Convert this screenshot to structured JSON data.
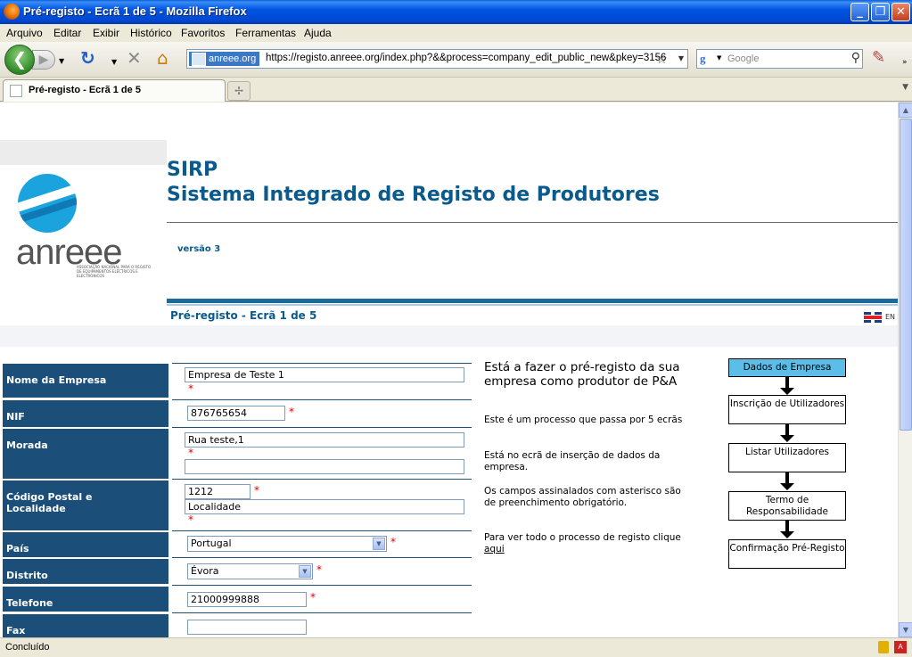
{
  "browser": {
    "window_title": "Pré-registo - Ecrã 1 de 5 - Mozilla Firefox",
    "menu": [
      "Arquivo",
      "Editar",
      "Exibir",
      "Histórico",
      "Favoritos",
      "Ferramentas",
      "Ajuda"
    ],
    "site_identity": "anreee.org",
    "url": "https://registo.anreee.org/index.php?&&process=company_edit_public_new&pkey=3156",
    "search_placeholder": "Google",
    "tab_title": "Pré-registo - Ecrã 1 de 5",
    "status": "Concluído"
  },
  "page": {
    "logo_text": "anreee",
    "logo_subtitle": "ASSOCIAÇÃO NACIONAL PARA O REGISTO DE EQUIPAMENTOS ELÉCTRICOS E ELECTRÓNICOS",
    "title_line1": "SIRP",
    "title_line2": "Sistema Integrado de Registo de Produtores",
    "version": "versão 3",
    "step_title": "Pré-registo - Ecrã 1 de 5",
    "lang": "EN"
  },
  "form": {
    "nome_label": "Nome da Empresa",
    "nome_value": "Empresa de Teste 1",
    "nif_label": "NIF",
    "nif_value": "876765654",
    "morada_label": "Morada",
    "morada_value1": "Rua teste,1",
    "morada_value2": "",
    "cp_label_1": "Código Postal e",
    "cp_label_2": "Localidade",
    "cp_value": "1212",
    "localidade_value": "Localidade",
    "pais_label": "País",
    "pais_value": "Portugal",
    "distrito_label": "Distrito",
    "distrito_value": "Évora",
    "telefone_label": "Telefone",
    "telefone_value": "21000999888",
    "fax_label": "Fax",
    "fax_value": "",
    "required_mark": "*"
  },
  "info": {
    "heading": "Está a fazer o pré-registo da sua empresa como produtor de P&A",
    "p1": "Este é um processo que passa por 5 ecrãs",
    "p2": "Está no ecrã de inserção de dados da empresa.",
    "p3": "Os campos assinalados com asterisco são de preenchimento obrigatório.",
    "p4": "Para ver todo o processo de registo clique",
    "p4_link": "aqui"
  },
  "flow": {
    "steps": [
      {
        "label": "Dados de Empresa",
        "active": true
      },
      {
        "label": "Inscrição de Utilizadores",
        "active": false
      },
      {
        "label": "Listar Utilizadores",
        "active": false
      },
      {
        "label": "Termo de Responsabilidade",
        "active": false
      },
      {
        "label": "Confirmação Pré-Registo",
        "active": false
      }
    ]
  },
  "colors": {
    "brand_blue": "#0a5a8c",
    "label_bg": "#1b4f7a",
    "active_step": "#5bbde8",
    "required": "#dd0000"
  },
  "icons": [
    "firefox-icon",
    "back-arrow-icon",
    "forward-arrow-icon",
    "reload-icon",
    "stop-icon",
    "home-icon",
    "star-icon",
    "google-icon",
    "search-icon",
    "addon-icon",
    "uk-flag-icon",
    "lock-icon",
    "pdf-icon"
  ]
}
